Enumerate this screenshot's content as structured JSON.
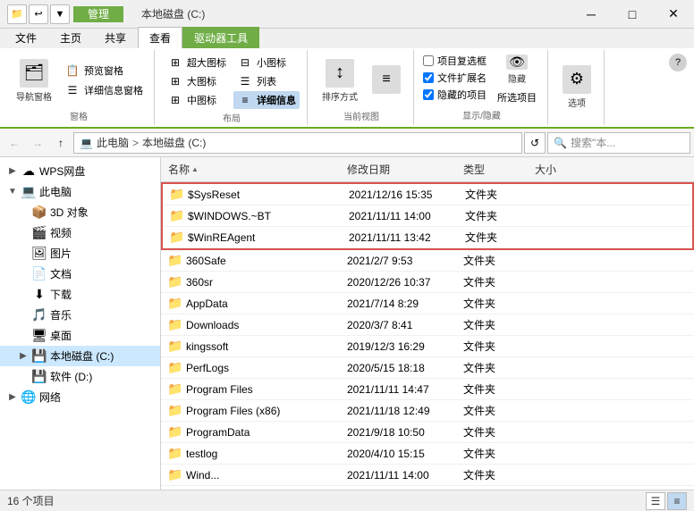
{
  "titlebar": {
    "title": "本地磁盘 (C:)",
    "manage_tab": "管理",
    "qat_buttons": [
      "📁",
      "↩",
      "▼"
    ],
    "controls": [
      "─",
      "□",
      "✕"
    ]
  },
  "ribbon": {
    "tabs": [
      {
        "label": "文件",
        "active": false
      },
      {
        "label": "主页",
        "active": false
      },
      {
        "label": "共享",
        "active": false
      },
      {
        "label": "查看",
        "active": true
      },
      {
        "label": "驱动器工具",
        "active": false
      }
    ],
    "groups": [
      {
        "label": "窗格",
        "buttons": [
          {
            "icon": "🗂",
            "label": "导航窗格"
          },
          {
            "icon": "📋",
            "label": "预览窗格"
          },
          {
            "icon": "ℹ",
            "label": "详细信息窗格"
          }
        ]
      },
      {
        "label": "布局",
        "small_buttons": [
          {
            "icon": "⊞",
            "label": "超大图标"
          },
          {
            "icon": "⊞",
            "label": "大图标"
          },
          {
            "icon": "⊞",
            "label": "中图标"
          },
          {
            "icon": "⊞",
            "label": "小图标"
          },
          {
            "icon": "☰",
            "label": "列表"
          },
          {
            "icon": "☰",
            "label": "详细信息",
            "active": true
          }
        ]
      },
      {
        "label": "当前视图",
        "buttons": [
          {
            "icon": "↕",
            "label": "排序方式"
          },
          {
            "icon": "≡",
            "label": ""
          }
        ]
      },
      {
        "label": "显示/隐藏",
        "checkboxes": [
          {
            "label": "项目复选框",
            "checked": false
          },
          {
            "label": "文件扩展名",
            "checked": true
          },
          {
            "label": "隐藏的项目",
            "checked": true
          }
        ],
        "buttons": [
          {
            "icon": "👁",
            "label": "隐藏"
          },
          {
            "icon": "📋",
            "label": "所选项目"
          }
        ]
      },
      {
        "label": "",
        "buttons": [
          {
            "icon": "⚙",
            "label": "选项"
          }
        ]
      }
    ]
  },
  "navbar": {
    "back_title": "后退",
    "forward_title": "前进",
    "up_title": "上一级",
    "breadcrumb": [
      {
        "label": "此电脑"
      },
      {
        "label": "本地磁盘 (C:)"
      }
    ],
    "search_placeholder": "搜索\"本..."
  },
  "sidebar": {
    "items": [
      {
        "label": "WPS网盘",
        "icon": "☁",
        "level": 0,
        "expand": "▶",
        "selected": false
      },
      {
        "label": "此电脑",
        "icon": "💻",
        "level": 0,
        "expand": "▼",
        "selected": false
      },
      {
        "label": "3D 对象",
        "icon": "📦",
        "level": 1,
        "expand": "",
        "selected": false
      },
      {
        "label": "视频",
        "icon": "🎬",
        "level": 1,
        "expand": "",
        "selected": false
      },
      {
        "label": "图片",
        "icon": "🖼",
        "level": 1,
        "expand": "",
        "selected": false
      },
      {
        "label": "文档",
        "icon": "📄",
        "level": 1,
        "expand": "",
        "selected": false
      },
      {
        "label": "下载",
        "icon": "⬇",
        "level": 1,
        "expand": "",
        "selected": false
      },
      {
        "label": "音乐",
        "icon": "🎵",
        "level": 1,
        "expand": "",
        "selected": false
      },
      {
        "label": "桌面",
        "icon": "🖥",
        "level": 1,
        "expand": "",
        "selected": false
      },
      {
        "label": "本地磁盘 (C:)",
        "icon": "💾",
        "level": 1,
        "expand": "▶",
        "selected": true
      },
      {
        "label": "软件 (D:)",
        "icon": "💾",
        "level": 1,
        "expand": "",
        "selected": false
      },
      {
        "label": "网络",
        "icon": "🌐",
        "level": 0,
        "expand": "▶",
        "selected": false
      }
    ]
  },
  "file_list": {
    "headers": [
      {
        "label": "名称",
        "col": "name",
        "sort": "▲"
      },
      {
        "label": "修改日期",
        "col": "date"
      },
      {
        "label": "类型",
        "col": "type"
      },
      {
        "label": "大小",
        "col": "size"
      }
    ],
    "files": [
      {
        "name": "$SysReset",
        "icon": "📁",
        "date": "2021/12/16 15:35",
        "type": "文件夹",
        "size": "",
        "highlighted": true
      },
      {
        "name": "$WINDOWS.~BT",
        "icon": "📁",
        "date": "2021/11/11 14:00",
        "type": "文件夹",
        "size": "",
        "highlighted": true
      },
      {
        "name": "$WinREAgent",
        "icon": "📁",
        "date": "2021/11/11 13:42",
        "type": "文件夹",
        "size": "",
        "highlighted": true
      },
      {
        "name": "360Safe",
        "icon": "📁",
        "date": "2021/2/7 9:53",
        "type": "文件夹",
        "size": "",
        "highlighted": false
      },
      {
        "name": "360sr",
        "icon": "📁",
        "date": "2020/12/26 10:37",
        "type": "文件夹",
        "size": "",
        "highlighted": false
      },
      {
        "name": "AppData",
        "icon": "📁",
        "date": "2021/7/14 8:29",
        "type": "文件夹",
        "size": "",
        "highlighted": false
      },
      {
        "name": "Downloads",
        "icon": "📁",
        "date": "2020/3/7 8:41",
        "type": "文件夹",
        "size": "",
        "highlighted": false
      },
      {
        "name": "kingssoft",
        "icon": "📁",
        "date": "2019/12/3 16:29",
        "type": "文件夹",
        "size": "",
        "highlighted": false
      },
      {
        "name": "PerfLogs",
        "icon": "📁",
        "date": "2020/5/15 18:18",
        "type": "文件夹",
        "size": "",
        "highlighted": false
      },
      {
        "name": "Program Files",
        "icon": "📁",
        "date": "2021/11/11 14:47",
        "type": "文件夹",
        "size": "",
        "highlighted": false
      },
      {
        "name": "Program Files (x86)",
        "icon": "📁",
        "date": "2021/11/18 12:49",
        "type": "文件夹",
        "size": "",
        "highlighted": false
      },
      {
        "name": "ProgramData",
        "icon": "📁",
        "date": "2021/9/18 10:50",
        "type": "文件夹",
        "size": "",
        "highlighted": false
      },
      {
        "name": "testlog",
        "icon": "📁",
        "date": "2020/4/10 15:15",
        "type": "文件夹",
        "size": "",
        "highlighted": false
      },
      {
        "name": "Wind...",
        "icon": "📁",
        "date": "2021/11/11 14:00",
        "type": "文件夹",
        "size": "",
        "highlighted": false
      }
    ]
  },
  "statusbar": {
    "count": "16 个项目",
    "view_buttons": [
      "list",
      "details"
    ]
  }
}
